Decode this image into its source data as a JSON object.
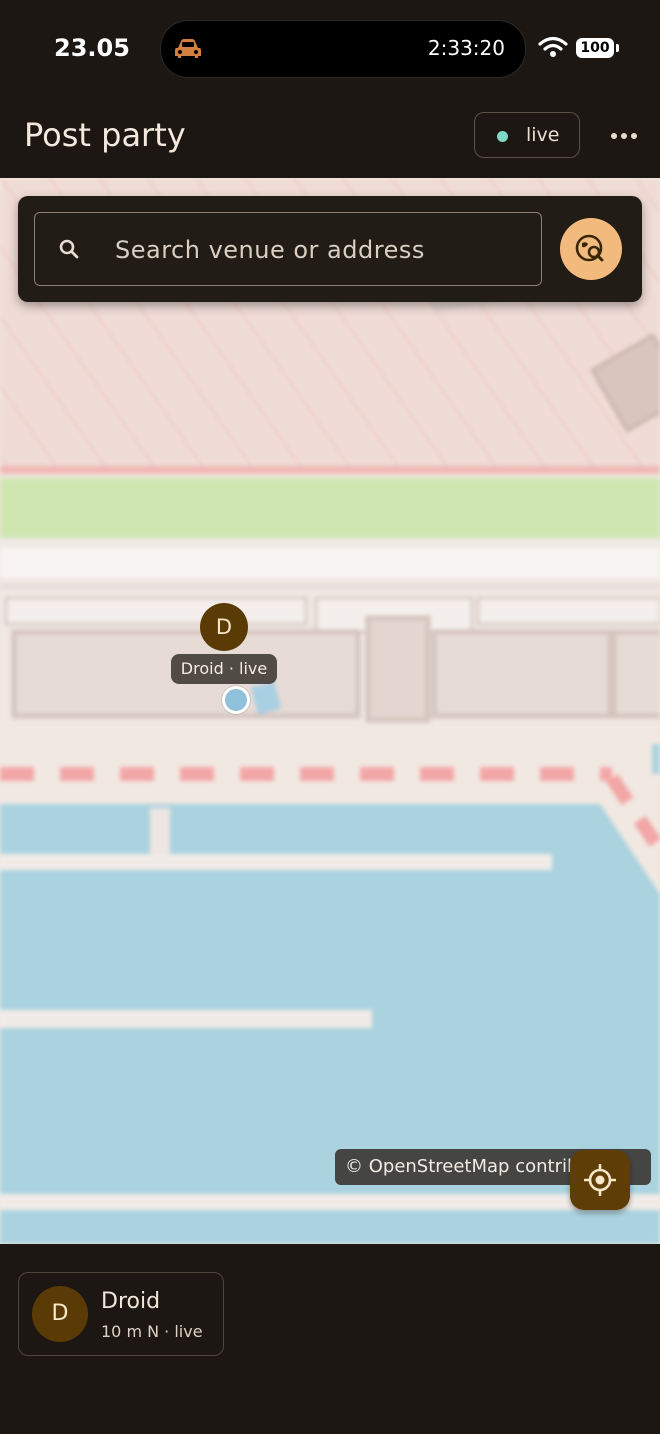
{
  "status_bar": {
    "time": "23.05",
    "live_activity_timer": "2:33:20",
    "battery": "100",
    "icons": [
      "car-icon",
      "wifi-icon",
      "battery-icon"
    ]
  },
  "app_bar": {
    "title": "Post party",
    "live_label": "live",
    "live_dot_color": "#7fd9c7",
    "more_icon": "more-horizontal-icon"
  },
  "search": {
    "placeholder": "Search venue or address",
    "value": "",
    "search_icon": "search-icon",
    "action_icon": "location-search-icon",
    "accent_color": "#f2bb7d"
  },
  "map": {
    "marker": {
      "initial": "D",
      "label": "Droid · live",
      "color": "#5a3b05"
    },
    "attribution": "© OpenStreetMap contributors",
    "recenter_icon": "my-location-icon"
  },
  "members": [
    {
      "initial": "D",
      "name": "Droid",
      "status": "10 m N · live"
    }
  ]
}
